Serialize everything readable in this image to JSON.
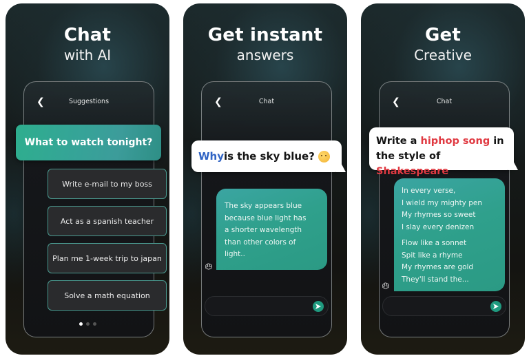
{
  "panels": [
    {
      "headline": {
        "title": "Chat",
        "subtitle": "with AI"
      },
      "screen": {
        "header_title": "Suggestions",
        "featured_prompt": "What to watch tonight?",
        "suggestions": [
          "Write e-mail to my boss",
          "Act as a spanish teacher",
          "Plan me 1-week trip to japan",
          "Solve a math equation"
        ],
        "pagination": {
          "total": 3,
          "active": 1
        }
      }
    },
    {
      "headline": {
        "title": "Get instant",
        "subtitle": "answers"
      },
      "screen": {
        "header_title": "Chat",
        "user_message": {
          "highlight": "Why",
          "rest": " is the sky blue?",
          "emoji": "thinking-face"
        },
        "ai_message": [
          "The sky appears blue",
          "because blue light has",
          "a shorter wavelength",
          "than other colors of",
          "light.."
        ],
        "input_placeholder": ""
      }
    },
    {
      "headline": {
        "title": "Get",
        "subtitle": "Creative"
      },
      "screen": {
        "header_title": "Chat",
        "user_message": {
          "part1": "Write a ",
          "highlight1": "hiphop song",
          "part2": " in the style of ",
          "highlight2": "Shakespeare"
        },
        "ai_message": {
          "stanza1": [
            "In every verse,",
            "I wield my mighty pen",
            "My rhymes so sweet",
            "I slay every denizen"
          ],
          "stanza2": [
            "Flow like a sonnet",
            "Spit like a rhyme",
            "My rhymes are gold",
            "They'll stand the..."
          ]
        },
        "input_placeholder": ""
      }
    }
  ],
  "colors": {
    "accent_teal": "#2fa08c",
    "send_button": "#1f9a7f",
    "highlight_blue": "#2f63c4",
    "highlight_red": "#e03a42",
    "suggestion_border": "#4a9a90"
  }
}
